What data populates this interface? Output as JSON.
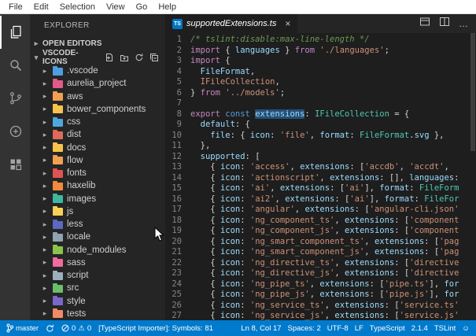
{
  "window": {
    "menu_items": [
      "File",
      "Edit",
      "Selection",
      "View",
      "Go",
      "Help"
    ]
  },
  "icons": {
    "chevron_right": "▸",
    "chevron_down": "▾",
    "close": "×",
    "more_actions": "…",
    "warning": "⚠",
    "smiley": "☺"
  },
  "activity_bar": {
    "items": [
      "explorer",
      "search",
      "source-control",
      "debug",
      "extensions"
    ]
  },
  "sidebar": {
    "title": "EXPLORER",
    "open_editors": {
      "label": "OPEN EDITORS"
    },
    "project": {
      "label": "VSCODE-ICONS"
    },
    "tree": [
      {
        "name": ".vscode",
        "color": "#4f9ee0"
      },
      {
        "name": "aurelia_project",
        "color": "#e05a8a"
      },
      {
        "name": "aws",
        "color": "#f0a050"
      },
      {
        "name": "bower_components",
        "color": "#f7c34c"
      },
      {
        "name": "css",
        "color": "#4fa7e0"
      },
      {
        "name": "dist",
        "color": "#e06a5a"
      },
      {
        "name": "docs",
        "color": "#f7c34c"
      },
      {
        "name": "flow",
        "color": "#f0a050"
      },
      {
        "name": "fonts",
        "color": "#e05353"
      },
      {
        "name": "haxelib",
        "color": "#f08a3c"
      },
      {
        "name": "images",
        "color": "#3cb9a0"
      },
      {
        "name": "js",
        "color": "#f7d154"
      },
      {
        "name": "less",
        "color": "#5a6ac0"
      },
      {
        "name": "locale",
        "color": "#8fa3b0"
      },
      {
        "name": "node_modules",
        "color": "#8bc34a"
      },
      {
        "name": "sass",
        "color": "#ef6ba0"
      },
      {
        "name": "script",
        "color": "#9ab0bc"
      },
      {
        "name": "src",
        "color": "#6abf69"
      },
      {
        "name": "style",
        "color": "#7a68c8"
      },
      {
        "name": "tests",
        "color": "#f08a65"
      }
    ]
  },
  "editor": {
    "tab": {
      "label": "supportedExtensions.ts",
      "badge": "TS"
    },
    "code": {
      "colors": {
        "c": "#6a9955",
        "k": "#c586c0",
        "kb": "#569cd6",
        "s": "#ce9178",
        "t": "#4ec9b0",
        "v": "#9cdcfe",
        "p": "#d4d4d4",
        "r": "#ce9178",
        "hl": "#9cdcfe"
      },
      "highlight_bg": "#264f78",
      "lines": [
        [
          [
            "/* tslint:disable:max-line-length */",
            "c"
          ]
        ],
        [
          [
            "import",
            "k"
          ],
          [
            " { ",
            "p"
          ],
          [
            "languages",
            "v"
          ],
          [
            " } ",
            "p"
          ],
          [
            "from",
            "k"
          ],
          [
            " ",
            "p"
          ],
          [
            "'./languages'",
            "s"
          ],
          [
            ";",
            "p"
          ]
        ],
        [
          [
            "import",
            "k"
          ],
          [
            " {",
            "p"
          ]
        ],
        [
          [
            "  FileFormat",
            "v"
          ],
          [
            ",",
            "p"
          ]
        ],
        [
          [
            "  IFileCollection",
            "r"
          ],
          [
            ",",
            "p"
          ]
        ],
        [
          [
            "} ",
            "p"
          ],
          [
            "from",
            "k"
          ],
          [
            " ",
            "p"
          ],
          [
            "'../models'",
            "s"
          ],
          [
            ";",
            "p"
          ]
        ],
        [],
        [
          [
            "export",
            "k"
          ],
          [
            " ",
            "p"
          ],
          [
            "const",
            "kb"
          ],
          [
            " ",
            "p"
          ],
          [
            "extensions",
            "hl"
          ],
          [
            ": ",
            "p"
          ],
          [
            "IFileCollection",
            "t"
          ],
          [
            " = {",
            "p"
          ]
        ],
        [
          [
            "  default",
            "v"
          ],
          [
            ": {",
            "p"
          ]
        ],
        [
          [
            "    file",
            "v"
          ],
          [
            ": { ",
            "p"
          ],
          [
            "icon",
            "v"
          ],
          [
            ": ",
            "p"
          ],
          [
            "'file'",
            "s"
          ],
          [
            ", ",
            "p"
          ],
          [
            "format",
            "v"
          ],
          [
            ": ",
            "p"
          ],
          [
            "FileFormat",
            "t"
          ],
          [
            ".",
            "p"
          ],
          [
            "svg",
            "v"
          ],
          [
            " },",
            "p"
          ]
        ],
        [
          [
            "  },",
            "p"
          ]
        ],
        [
          [
            "  supported",
            "v"
          ],
          [
            ": [",
            "p"
          ]
        ],
        [
          [
            "    { ",
            "p"
          ],
          [
            "icon",
            "v"
          ],
          [
            ": ",
            "p"
          ],
          [
            "'access'",
            "s"
          ],
          [
            ", ",
            "p"
          ],
          [
            "extensions",
            "v"
          ],
          [
            ": [",
            "p"
          ],
          [
            "'accdb'",
            "s"
          ],
          [
            ", ",
            "p"
          ],
          [
            "'accdt'",
            "s"
          ],
          [
            ",",
            "p"
          ]
        ],
        [
          [
            "    { ",
            "p"
          ],
          [
            "icon",
            "v"
          ],
          [
            ": ",
            "p"
          ],
          [
            "'actionscript'",
            "s"
          ],
          [
            ", ",
            "p"
          ],
          [
            "extensions",
            "v"
          ],
          [
            ": [], ",
            "p"
          ],
          [
            "languages",
            "v"
          ],
          [
            ":",
            "p"
          ]
        ],
        [
          [
            "    { ",
            "p"
          ],
          [
            "icon",
            "v"
          ],
          [
            ": ",
            "p"
          ],
          [
            "'ai'",
            "s"
          ],
          [
            ", ",
            "p"
          ],
          [
            "extensions",
            "v"
          ],
          [
            ": [",
            "p"
          ],
          [
            "'ai'",
            "s"
          ],
          [
            "], ",
            "p"
          ],
          [
            "format",
            "v"
          ],
          [
            ": ",
            "p"
          ],
          [
            "FileForm",
            "t"
          ]
        ],
        [
          [
            "    { ",
            "p"
          ],
          [
            "icon",
            "v"
          ],
          [
            ": ",
            "p"
          ],
          [
            "'ai2'",
            "s"
          ],
          [
            ", ",
            "p"
          ],
          [
            "extensions",
            "v"
          ],
          [
            ": [",
            "p"
          ],
          [
            "'ai'",
            "s"
          ],
          [
            "], ",
            "p"
          ],
          [
            "format",
            "v"
          ],
          [
            ": ",
            "p"
          ],
          [
            "FileFor",
            "t"
          ]
        ],
        [
          [
            "    { ",
            "p"
          ],
          [
            "icon",
            "v"
          ],
          [
            ": ",
            "p"
          ],
          [
            "'angular'",
            "s"
          ],
          [
            ", ",
            "p"
          ],
          [
            "extensions",
            "v"
          ],
          [
            ": [",
            "p"
          ],
          [
            "'angular-cli.json'",
            "s"
          ]
        ],
        [
          [
            "    { ",
            "p"
          ],
          [
            "icon",
            "v"
          ],
          [
            ": ",
            "p"
          ],
          [
            "'ng_component_ts'",
            "s"
          ],
          [
            ", ",
            "p"
          ],
          [
            "extensions",
            "v"
          ],
          [
            ": [",
            "p"
          ],
          [
            "'component",
            "s"
          ]
        ],
        [
          [
            "    { ",
            "p"
          ],
          [
            "icon",
            "v"
          ],
          [
            ": ",
            "p"
          ],
          [
            "'ng_component_js'",
            "s"
          ],
          [
            ", ",
            "p"
          ],
          [
            "extensions",
            "v"
          ],
          [
            ": [",
            "p"
          ],
          [
            "'component",
            "s"
          ]
        ],
        [
          [
            "    { ",
            "p"
          ],
          [
            "icon",
            "v"
          ],
          [
            ": ",
            "p"
          ],
          [
            "'ng_smart_component_ts'",
            "s"
          ],
          [
            ", ",
            "p"
          ],
          [
            "extensions",
            "v"
          ],
          [
            ": [",
            "p"
          ],
          [
            "'pag",
            "s"
          ]
        ],
        [
          [
            "    { ",
            "p"
          ],
          [
            "icon",
            "v"
          ],
          [
            ": ",
            "p"
          ],
          [
            "'ng_smart_component_js'",
            "s"
          ],
          [
            ", ",
            "p"
          ],
          [
            "extensions",
            "v"
          ],
          [
            ": [",
            "p"
          ],
          [
            "'pag",
            "s"
          ]
        ],
        [
          [
            "    { ",
            "p"
          ],
          [
            "icon",
            "v"
          ],
          [
            ": ",
            "p"
          ],
          [
            "'ng_directive_ts'",
            "s"
          ],
          [
            ", ",
            "p"
          ],
          [
            "extensions",
            "v"
          ],
          [
            ": [",
            "p"
          ],
          [
            "'directive",
            "s"
          ]
        ],
        [
          [
            "    { ",
            "p"
          ],
          [
            "icon",
            "v"
          ],
          [
            ": ",
            "p"
          ],
          [
            "'ng_directive_js'",
            "s"
          ],
          [
            ", ",
            "p"
          ],
          [
            "extensions",
            "v"
          ],
          [
            ": [",
            "p"
          ],
          [
            "'directive",
            "s"
          ]
        ],
        [
          [
            "    { ",
            "p"
          ],
          [
            "icon",
            "v"
          ],
          [
            ": ",
            "p"
          ],
          [
            "'ng_pipe_ts'",
            "s"
          ],
          [
            ", ",
            "p"
          ],
          [
            "extensions",
            "v"
          ],
          [
            ": [",
            "p"
          ],
          [
            "'pipe.ts'",
            "s"
          ],
          [
            "], ",
            "p"
          ],
          [
            "for",
            "v"
          ]
        ],
        [
          [
            "    { ",
            "p"
          ],
          [
            "icon",
            "v"
          ],
          [
            ": ",
            "p"
          ],
          [
            "'ng_pipe_js'",
            "s"
          ],
          [
            ", ",
            "p"
          ],
          [
            "extensions",
            "v"
          ],
          [
            ": [",
            "p"
          ],
          [
            "'pipe.js'",
            "s"
          ],
          [
            "], ",
            "p"
          ],
          [
            "for",
            "v"
          ]
        ],
        [
          [
            "    { ",
            "p"
          ],
          [
            "icon",
            "v"
          ],
          [
            ": ",
            "p"
          ],
          [
            "'ng_service_ts'",
            "s"
          ],
          [
            ", ",
            "p"
          ],
          [
            "extensions",
            "v"
          ],
          [
            ": [",
            "p"
          ],
          [
            "'service.ts'",
            "s"
          ]
        ],
        [
          [
            "    { ",
            "p"
          ],
          [
            "icon",
            "v"
          ],
          [
            ": ",
            "p"
          ],
          [
            "'ng_service_js'",
            "s"
          ],
          [
            ", ",
            "p"
          ],
          [
            "extensions",
            "v"
          ],
          [
            ": [",
            "p"
          ],
          [
            "'service.js'",
            "s"
          ]
        ]
      ]
    }
  },
  "status_bar": {
    "branch": "master",
    "errors": "0",
    "warnings": "0",
    "message": "[TypeScript Importer]: Symbols: 81",
    "cursor": "Ln 8, Col 17",
    "spaces": "Spaces: 2",
    "encoding": "UTF-8",
    "eol": "LF",
    "language": "TypeScript",
    "ts_version": "2.1.4",
    "linter": "TSLint"
  }
}
